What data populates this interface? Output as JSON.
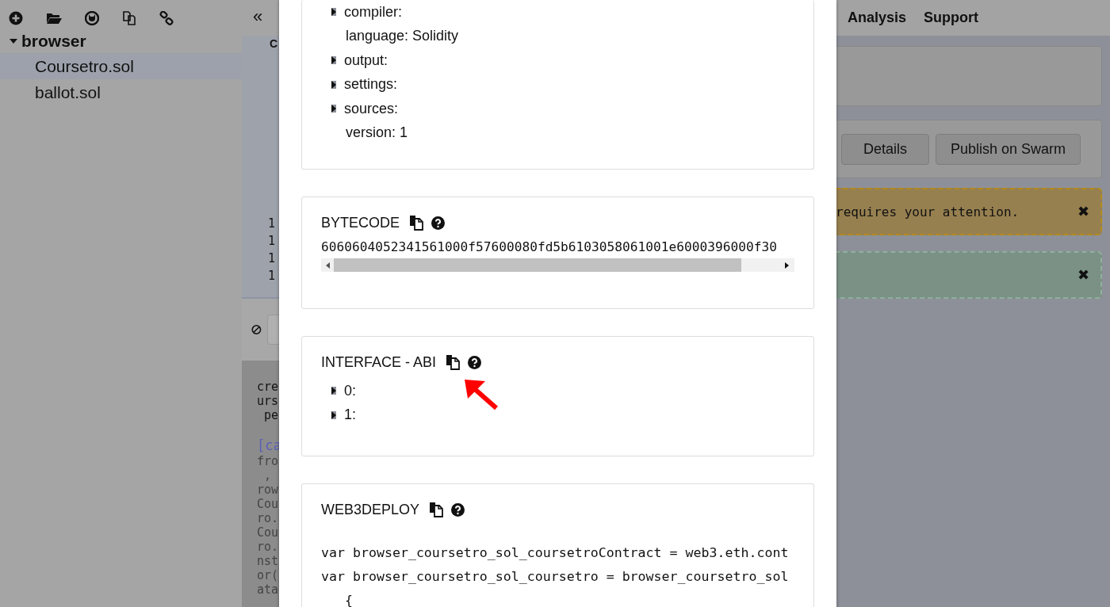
{
  "sidebar": {
    "folder": {
      "label": "browser",
      "expanded": true,
      "children": [
        {
          "label": "Coursetro.sol",
          "selected": true
        },
        {
          "label": "ballot.sol",
          "selected": false
        }
      ]
    }
  },
  "editor": {
    "collapse_button": "«",
    "tab_label": "C",
    "line_numbers": [
      "1",
      "1",
      "1",
      "1"
    ]
  },
  "terminal": {
    "lines": [
      {
        "text": "cre",
        "kind": "plain"
      },
      {
        "text": "urs",
        "kind": "plain"
      },
      {
        "text": " pe",
        "kind": "plain"
      },
      {
        "text": "[ca",
        "kind": "link"
      },
      {
        "text": "fro",
        "kind": "log"
      },
      {
        "text": " ,",
        "kind": "log"
      },
      {
        "text": "row",
        "kind": "log"
      },
      {
        "text": "Cou",
        "kind": "log"
      },
      {
        "text": "ro.",
        "kind": "log"
      },
      {
        "text": "Cou",
        "kind": "log"
      },
      {
        "text": "ro.",
        "kind": "log"
      },
      {
        "text": "nst",
        "kind": "log"
      },
      {
        "text": "or(",
        "kind": "log"
      },
      {
        "text": "ata",
        "kind": "log"
      }
    ]
  },
  "modal": {
    "metadata": {
      "items": [
        {
          "label": "compiler:",
          "kind": "branch",
          "expanded": false
        },
        {
          "label": "language: Solidity",
          "kind": "leaf"
        },
        {
          "label": "output:",
          "kind": "branch",
          "expanded": false
        },
        {
          "label": "settings:",
          "kind": "branch",
          "expanded": false
        },
        {
          "label": "sources:",
          "kind": "branch",
          "expanded": false
        },
        {
          "label": "version: 1",
          "kind": "leaf"
        }
      ]
    },
    "bytecode": {
      "title": "BYTECODE",
      "value": "6060604052341561000f57600080fd5b6103058061001e6000396000f30"
    },
    "interface": {
      "title": "INTERFACE - ABI",
      "items": [
        {
          "label": "0:",
          "kind": "branch",
          "expanded": false
        },
        {
          "label": "1:",
          "kind": "branch",
          "expanded": false
        }
      ]
    },
    "web3deploy": {
      "title": "WEB3DEPLOY",
      "lines": [
        "var browser_coursetro_sol_coursetroContract = web3.eth.cont",
        "var browser_coursetro_sol_coursetro = browser_coursetro_sol",
        "   {"
      ]
    }
  },
  "menu": [
    "Analysis",
    "Support"
  ],
  "buttons": [
    "Details",
    "Publish on Swarm"
  ],
  "alerts": [
    {
      "kind": "warning",
      "text": "requires your attention.",
      "close": "✖"
    },
    {
      "kind": "success",
      "close": "✖"
    }
  ]
}
